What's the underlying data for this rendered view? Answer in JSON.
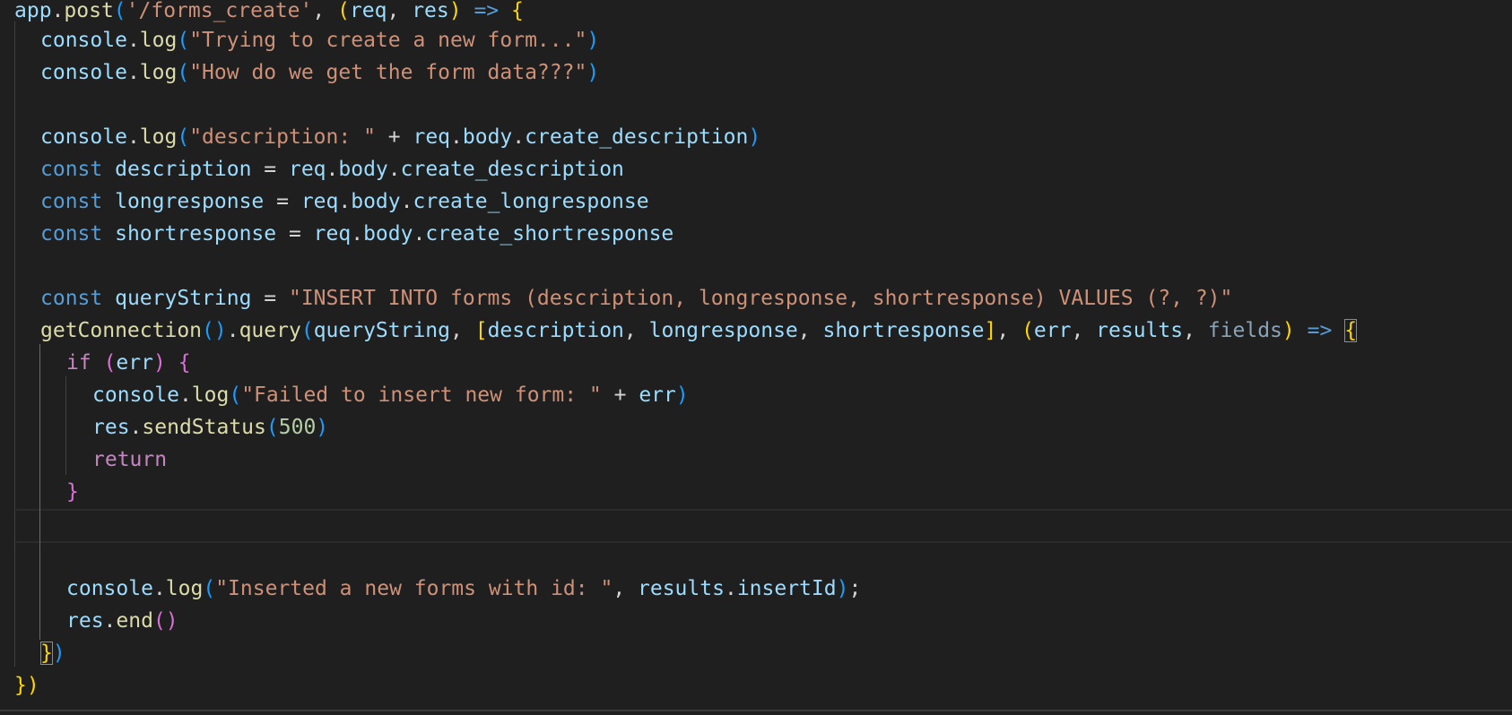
{
  "code_lines": [
    [
      [
        "app",
        "var"
      ],
      [
        ".",
        "op"
      ],
      [
        "post",
        "fn"
      ],
      [
        "(",
        "p3"
      ],
      [
        "'/forms_create'",
        "str"
      ],
      [
        ", ",
        "op"
      ],
      [
        "(",
        "p1"
      ],
      [
        "req",
        "var"
      ],
      [
        ", ",
        "op"
      ],
      [
        "res",
        "var"
      ],
      [
        ")",
        "p1"
      ],
      [
        " ",
        "op"
      ],
      [
        "=>",
        "kw"
      ],
      [
        " ",
        "op"
      ],
      [
        "{",
        "p1"
      ]
    ],
    [
      [
        "console",
        "var"
      ],
      [
        ".",
        "op"
      ],
      [
        "log",
        "fn"
      ],
      [
        "(",
        "p3"
      ],
      [
        "\"Trying to create a new form...\"",
        "str"
      ],
      [
        ")",
        "p3"
      ]
    ],
    [
      [
        "console",
        "var"
      ],
      [
        ".",
        "op"
      ],
      [
        "log",
        "fn"
      ],
      [
        "(",
        "p3"
      ],
      [
        "\"How do we get the form data???\"",
        "str"
      ],
      [
        ")",
        "p3"
      ]
    ],
    [],
    [
      [
        "console",
        "var"
      ],
      [
        ".",
        "op"
      ],
      [
        "log",
        "fn"
      ],
      [
        "(",
        "p3"
      ],
      [
        "\"description: \"",
        "str"
      ],
      [
        " + ",
        "op"
      ],
      [
        "req",
        "var"
      ],
      [
        ".",
        "op"
      ],
      [
        "body",
        "var"
      ],
      [
        ".",
        "op"
      ],
      [
        "create_description",
        "var"
      ],
      [
        ")",
        "p3"
      ]
    ],
    [
      [
        "const",
        "kw"
      ],
      [
        " ",
        "op"
      ],
      [
        "description",
        "var"
      ],
      [
        " = ",
        "op"
      ],
      [
        "req",
        "var"
      ],
      [
        ".",
        "op"
      ],
      [
        "body",
        "var"
      ],
      [
        ".",
        "op"
      ],
      [
        "create_description",
        "var"
      ]
    ],
    [
      [
        "const",
        "kw"
      ],
      [
        " ",
        "op"
      ],
      [
        "longresponse",
        "var"
      ],
      [
        " = ",
        "op"
      ],
      [
        "req",
        "var"
      ],
      [
        ".",
        "op"
      ],
      [
        "body",
        "var"
      ],
      [
        ".",
        "op"
      ],
      [
        "create_longresponse",
        "var"
      ]
    ],
    [
      [
        "const",
        "kw"
      ],
      [
        " ",
        "op"
      ],
      [
        "shortresponse",
        "var"
      ],
      [
        " = ",
        "op"
      ],
      [
        "req",
        "var"
      ],
      [
        ".",
        "op"
      ],
      [
        "body",
        "var"
      ],
      [
        ".",
        "op"
      ],
      [
        "create_shortresponse",
        "var"
      ]
    ],
    [],
    [
      [
        "const",
        "kw"
      ],
      [
        " ",
        "op"
      ],
      [
        "queryString",
        "var"
      ],
      [
        " = ",
        "op"
      ],
      [
        "\"INSERT INTO forms (description, longresponse, shortresponse) VALUES (?, ?)\"",
        "str"
      ]
    ],
    [
      [
        "getConnection",
        "fn"
      ],
      [
        "()",
        "p3"
      ],
      [
        ".",
        "op"
      ],
      [
        "query",
        "fn"
      ],
      [
        "(",
        "p3"
      ],
      [
        "queryString",
        "var"
      ],
      [
        ", ",
        "op"
      ],
      [
        "[",
        "p1"
      ],
      [
        "description",
        "var"
      ],
      [
        ", ",
        "op"
      ],
      [
        "longresponse",
        "var"
      ],
      [
        ", ",
        "op"
      ],
      [
        "shortresponse",
        "var"
      ],
      [
        "]",
        "p1"
      ],
      [
        ", ",
        "op"
      ],
      [
        "(",
        "p1"
      ],
      [
        "err",
        "var"
      ],
      [
        ", ",
        "op"
      ],
      [
        "results",
        "var"
      ],
      [
        ", ",
        "op"
      ],
      [
        "fields",
        "dim"
      ],
      [
        ")",
        "p1"
      ],
      [
        " ",
        "op"
      ],
      [
        "=>",
        "kw"
      ],
      [
        " ",
        "op"
      ],
      [
        "{",
        "p1",
        "bm"
      ]
    ],
    [
      [
        "if",
        "ctl"
      ],
      [
        " ",
        "op"
      ],
      [
        "(",
        "p2"
      ],
      [
        "err",
        "var"
      ],
      [
        ")",
        "p2"
      ],
      [
        " ",
        "op"
      ],
      [
        "{",
        "p2"
      ]
    ],
    [
      [
        "console",
        "var"
      ],
      [
        ".",
        "op"
      ],
      [
        "log",
        "fn"
      ],
      [
        "(",
        "p3"
      ],
      [
        "\"Failed to insert new form: \"",
        "str"
      ],
      [
        " + ",
        "op"
      ],
      [
        "err",
        "var"
      ],
      [
        ")",
        "p3"
      ]
    ],
    [
      [
        "res",
        "var"
      ],
      [
        ".",
        "op"
      ],
      [
        "sendStatus",
        "fn"
      ],
      [
        "(",
        "p3"
      ],
      [
        "500",
        "num"
      ],
      [
        ")",
        "p3"
      ]
    ],
    [
      [
        "return",
        "ctl"
      ]
    ],
    [
      [
        "}",
        "p2"
      ]
    ],
    [],
    [],
    [
      [
        "console",
        "var"
      ],
      [
        ".",
        "op"
      ],
      [
        "log",
        "fn"
      ],
      [
        "(",
        "p3"
      ],
      [
        "\"Inserted a new forms with id: \"",
        "str"
      ],
      [
        ", ",
        "op"
      ],
      [
        "results",
        "var"
      ],
      [
        ".",
        "op"
      ],
      [
        "insertId",
        "var"
      ],
      [
        ")",
        "p3"
      ],
      [
        ";",
        "op"
      ]
    ],
    [
      [
        "res",
        "var"
      ],
      [
        ".",
        "op"
      ],
      [
        "end",
        "fn"
      ],
      [
        "()",
        "p2"
      ]
    ],
    [
      [
        "}",
        "p1",
        "bm"
      ],
      [
        ")",
        "p3"
      ]
    ],
    [
      [
        "}",
        "p1"
      ],
      [
        ")",
        "p1"
      ]
    ]
  ]
}
